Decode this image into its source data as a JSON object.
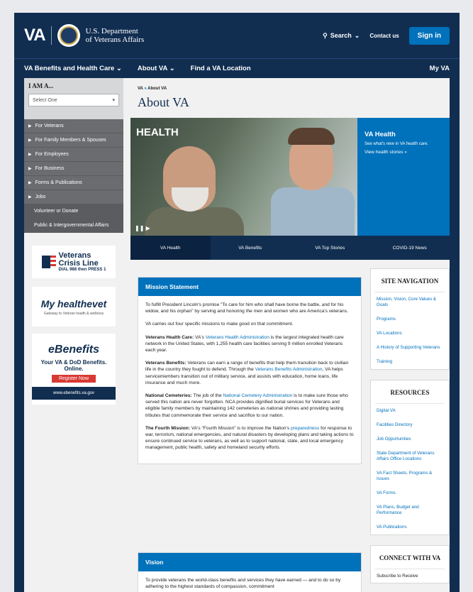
{
  "header": {
    "logo": "VA",
    "dept_line1": "U.S. Department",
    "dept_line2": "of Veterans Affairs",
    "search": "Search",
    "contact": "Contact us",
    "signin": "Sign in"
  },
  "nav": {
    "items": [
      "VA Benefits and Health Care",
      "About VA",
      "Find a VA Location"
    ],
    "my_va": "My VA"
  },
  "left": {
    "iam_title": "I AM A...",
    "select_value": "Select One",
    "menu": [
      {
        "label": "For Veterans",
        "arrow": true
      },
      {
        "label": "For Family Members & Spouses",
        "arrow": true
      },
      {
        "label": "For Employees",
        "arrow": true
      },
      {
        "label": "For Business",
        "arrow": true
      },
      {
        "label": "Forms & Publications",
        "arrow": true
      },
      {
        "label": "Jobs",
        "arrow": true
      },
      {
        "label": "Volunteer or Donate",
        "arrow": false
      },
      {
        "label": "Public & Intergovernmental Affairs",
        "arrow": false
      }
    ],
    "crisis_line1": "Veterans",
    "crisis_line2": "Crisis Line",
    "crisis_dial": "DIAL 988 then PRESS 1",
    "healthevet": "My healthevet",
    "healthevet_sub": "Gateway to Veteran health & wellness",
    "ebenefits": "eBenefits",
    "ebenefits_text": "Your VA & DoD Benefits. Online.",
    "ebenefits_btn": "Register Now",
    "ebenefits_url": "www.ebenefits.va.gov"
  },
  "main": {
    "breadcrumb": [
      "VA",
      "About VA"
    ],
    "breadcrumb_sep": "»",
    "title": "About VA",
    "hero": {
      "label": "HEALTH",
      "side_title": "VA Health",
      "side_text": "See what's new in VA health care.",
      "side_link": "View health stories »"
    },
    "tabs": [
      "VA Health",
      "VA Benefits",
      "VA Top Stories",
      "COVID-19 News"
    ],
    "mission": {
      "heading": "Mission Statement",
      "p1": "To fulfill President Lincoln's promise \"To care for him who shall have borne the battle, and for his widow, and his orphan\" by serving and honoring the men and women who are America's veterans.",
      "p2": "VA carries out four specific missions to make good on that commitment.",
      "health_label": "Veterans Health Care:",
      "health_pre": " VA's ",
      "health_link": "Veterans Health Administration",
      "health_post": " is the largest integrated health care network in the United States, with 1,255 health care facilities serving 9 million enrolled Veterans each year.",
      "benefits_label": "Veterans Benefits:",
      "benefits_pre": " Veterans can earn a range of benefits that help them transition back to civilian life in the country they fought to defend. Through the ",
      "benefits_link": "Veterans Benefits Administration",
      "benefits_post": ", VA helps servicemembers transition out of military service, and assists with education, home loans, life insurance and much more.",
      "cem_label": "National Cemeteries:",
      "cem_pre": " The job of the ",
      "cem_link": "National Cemetery Administration",
      "cem_post": " is to make sure those who served this nation are never forgotten. NCA provides dignified burial services for Veterans and eligible family members by maintaining 142 cemeteries as national shrines and providing lasting tributes that commemorate their service and sacrifice to our nation.",
      "fourth_label": "The Fourth Mission:",
      "fourth_pre": " VA's \"Fourth Mission\" is to improve the Nation's ",
      "fourth_link": "preparedness",
      "fourth_post": " for response to war, terrorism, national emergencies, and natural disasters by developing plans and taking actions to ensure continued service to veterans, as well as to support national, state, and local emergency management, public health, safety and homeland security efforts."
    },
    "vision": {
      "heading": "Vision",
      "p1": "To provide veterans the world-class benefits and services they have earned — and to do so by adhering to the highest standards of compassion, commitment"
    }
  },
  "right": {
    "site_nav_title": "SITE NAVIGATION",
    "site_nav": [
      "Mission, Vision, Core Values & Goals",
      "Programs",
      "VA Locations",
      "A History of Supporting Veterans",
      "Training"
    ],
    "resources_title": "RESOURCES",
    "resources": [
      "Digital VA",
      "Facilities Directory",
      "Job Opportunities",
      "State Department of Veterans Affairs Office Locations",
      "VA Fact Sheets, Programs & Issues",
      "VA Forms",
      "VA Plans, Budget and Performance",
      "VA Publications"
    ],
    "connect_title": "CONNECT WITH VA",
    "connect_text": "Subscribe to Receive"
  }
}
